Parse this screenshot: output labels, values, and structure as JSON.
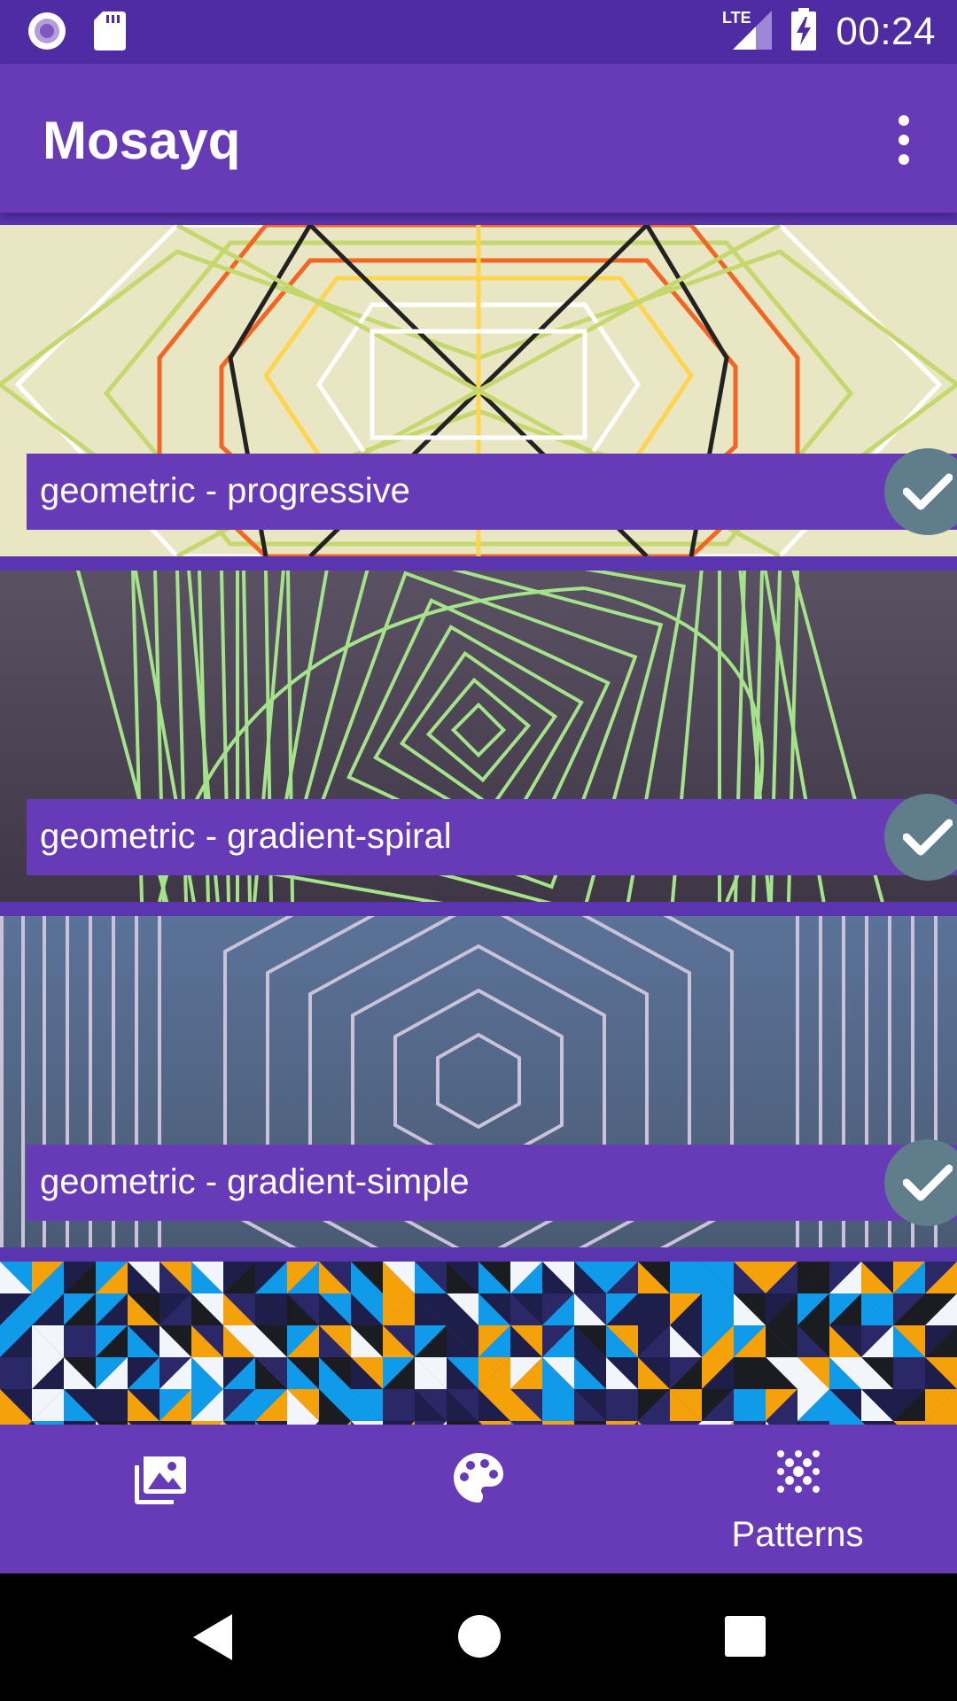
{
  "status_bar": {
    "time": "00:24",
    "network_label": "LTE",
    "icons": [
      "recording-icon",
      "sd-card-icon",
      "signal-icon",
      "battery-charging-icon"
    ]
  },
  "app_bar": {
    "title": "Mosayq",
    "overflow_icon": "more-vert-icon"
  },
  "patterns": [
    {
      "label": "geometric - progressive",
      "selected": true
    },
    {
      "label": "geometric - gradient-spiral",
      "selected": true
    },
    {
      "label": "geometric - gradient-simple",
      "selected": true
    }
  ],
  "bottom_nav": {
    "items": [
      {
        "icon": "photo-library-icon",
        "label": ""
      },
      {
        "icon": "palette-icon",
        "label": ""
      },
      {
        "icon": "patterns-icon",
        "label": "Patterns",
        "active": true
      }
    ]
  },
  "colors": {
    "primary": "#673ab7",
    "status_bar": "#4f2ca4",
    "check_circle": "#5f7d8a"
  }
}
